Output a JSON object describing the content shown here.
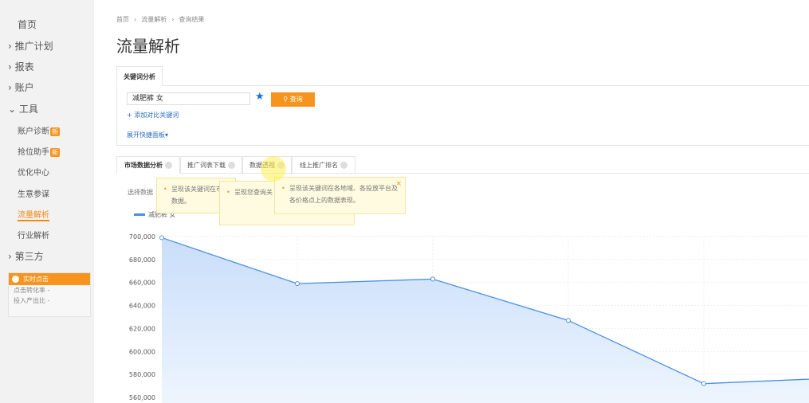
{
  "sidebar": {
    "items": [
      {
        "label": "首页",
        "chev": ""
      },
      {
        "label": "推广计划",
        "chev": "›"
      },
      {
        "label": "报表",
        "chev": "›"
      },
      {
        "label": "账户",
        "chev": "›"
      },
      {
        "label": "工具",
        "chev": "⌄"
      }
    ],
    "tools": [
      {
        "label": "账户诊断",
        "badge": "新"
      },
      {
        "label": "抢位助手",
        "badge": "新"
      },
      {
        "label": "优化中心"
      },
      {
        "label": "生意参谋"
      },
      {
        "label": "流量解析",
        "active": true
      },
      {
        "label": "行业解析"
      }
    ],
    "third": "第三方",
    "realtime": {
      "title": "实时点击",
      "rows": [
        "点击转化率  -",
        "投入产出比  -"
      ]
    }
  },
  "breadcrumb": [
    "首页",
    "›",
    "流量解析",
    "›",
    "查询结果"
  ],
  "page_title": "流量解析",
  "keyword_tab": "关键词分析",
  "keyword_input": "减肥裤 女",
  "query_button": "查询",
  "add_keyword": "+ 添加对比关键词",
  "expand_panel": "展开快捷面板▾",
  "tabs": [
    "市场数据分析",
    "推广词表下载",
    "数据透视",
    "线上推广排名"
  ],
  "select_label": "选择数据",
  "tooltips": [
    "呈现该关键词在市 数据。",
    "呈现您查询关 该词的匹配 期的展现指数",
    "呈现该关键词在各地域、各投放平台及 各价格点上的数据表现。"
  ],
  "chart_data": {
    "type": "area",
    "series": [
      {
        "name": "减肥裤 女",
        "values": [
          699000,
          659000,
          663000,
          627000,
          572000,
          577000
        ]
      }
    ],
    "yticks": [
      "700,000",
      "680,000",
      "660,000",
      "640,000",
      "620,000",
      "600,000",
      "580,000",
      "560,000"
    ],
    "ylim": [
      560000,
      700000
    ],
    "grid": true,
    "color": "#4a90e2",
    "legend": "top-left"
  }
}
